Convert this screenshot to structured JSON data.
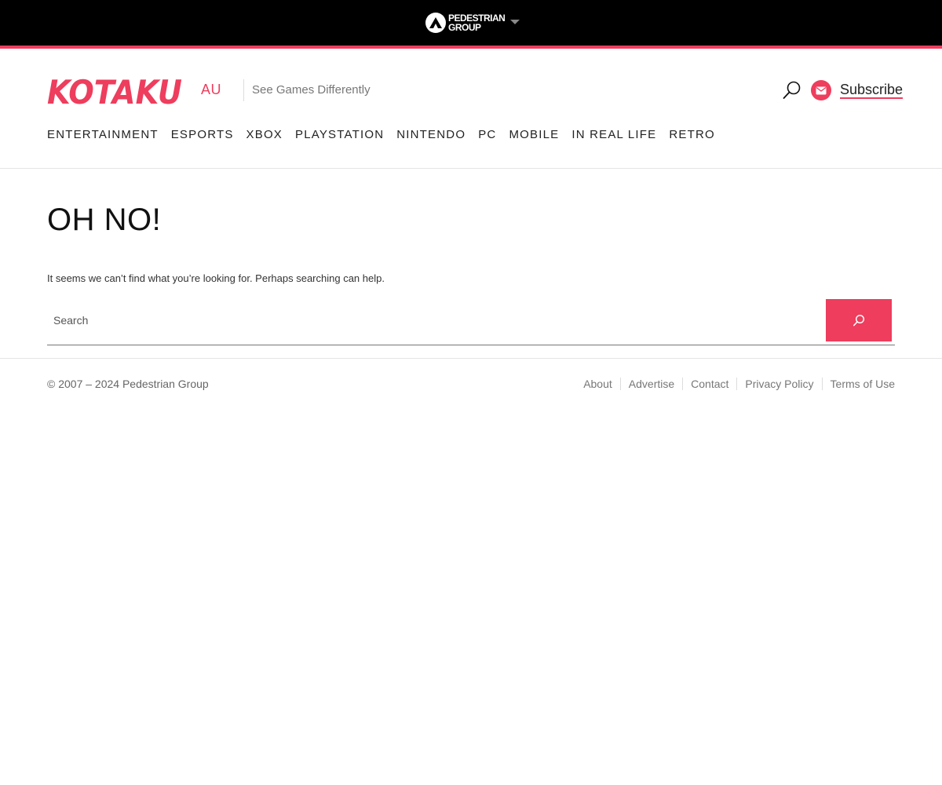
{
  "topbar": {
    "brand_line1": "PEDESTRIAN",
    "brand_line2": "GROUP"
  },
  "header": {
    "logo_text": "KOTAKU",
    "region": "AU",
    "tagline": "See Games Differently",
    "subscribe_label": "Subscribe"
  },
  "nav": {
    "items": [
      "ENTERTAINMENT",
      "ESPORTS",
      "XBOX",
      "PLAYSTATION",
      "NINTENDO",
      "PC",
      "MOBILE",
      "IN REAL LIFE",
      "RETRO"
    ]
  },
  "main": {
    "title": "OH NO!",
    "message": "It seems we can’t find what you’re looking for. Perhaps searching can help.",
    "search_placeholder": "Search",
    "search_value": ""
  },
  "footer": {
    "copyright": "© 2007 – 2024 Pedestrian Group",
    "links": [
      "About",
      "Advertise",
      "Contact",
      "Privacy Policy",
      "Terms of Use"
    ]
  },
  "colors": {
    "accent": "#ee3d5d",
    "topbar": "#000000"
  },
  "icons": {
    "pg": "pedestrian-group-icon",
    "dropdown": "caret-down-icon",
    "search": "search-icon",
    "mail": "mail-icon"
  }
}
